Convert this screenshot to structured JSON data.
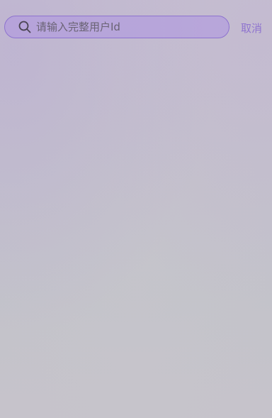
{
  "search": {
    "placeholder": "请输入完整用户Id",
    "value": "",
    "icon": "search-icon"
  },
  "header": {
    "cancel_label": "取消"
  },
  "colors": {
    "accent": "#8f74cf",
    "search_fill": "#b09ade",
    "background": "#c5c2cc"
  }
}
